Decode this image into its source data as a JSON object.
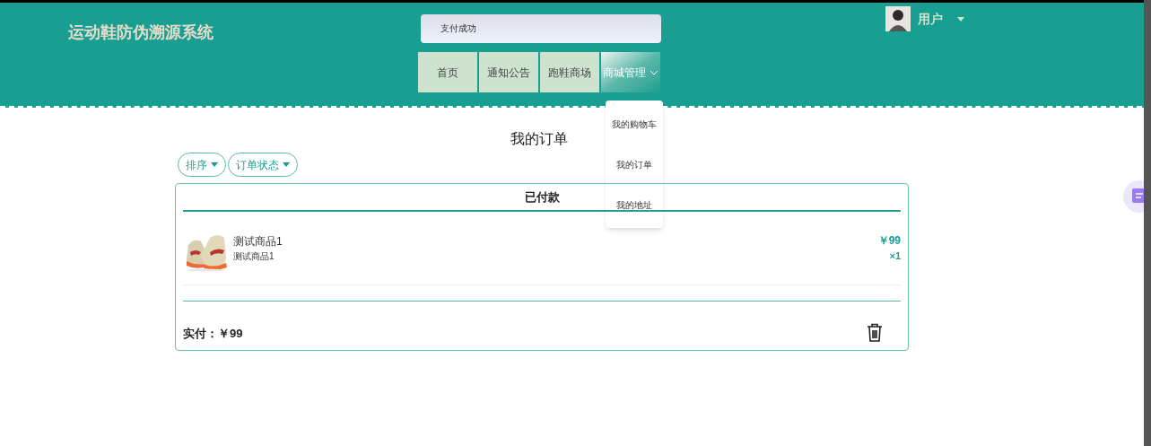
{
  "header": {
    "title": "运动鞋防伪溯源系统",
    "search": {
      "value": "支付成功"
    },
    "user": {
      "name": "用户"
    }
  },
  "nav": [
    {
      "label": "首页",
      "selected": false,
      "dropdown": false
    },
    {
      "label": "通知公告",
      "selected": false,
      "dropdown": false
    },
    {
      "label": "跑鞋商场",
      "selected": false,
      "dropdown": false
    },
    {
      "label": "商城管理",
      "selected": true,
      "dropdown": true
    }
  ],
  "menu": {
    "expanded": true,
    "items": [
      "我的购物车",
      "我的订单",
      "我的地址"
    ]
  },
  "page_title": "我的订单",
  "filters": [
    "排序",
    "订单状态"
  ],
  "order": {
    "status": "已付款",
    "items": [
      {
        "name": "测试商品1",
        "subtitle": "测试商品1",
        "price": "￥99",
        "quantity": "×1"
      }
    ],
    "total_label": "实付：",
    "total": "￥99"
  }
}
